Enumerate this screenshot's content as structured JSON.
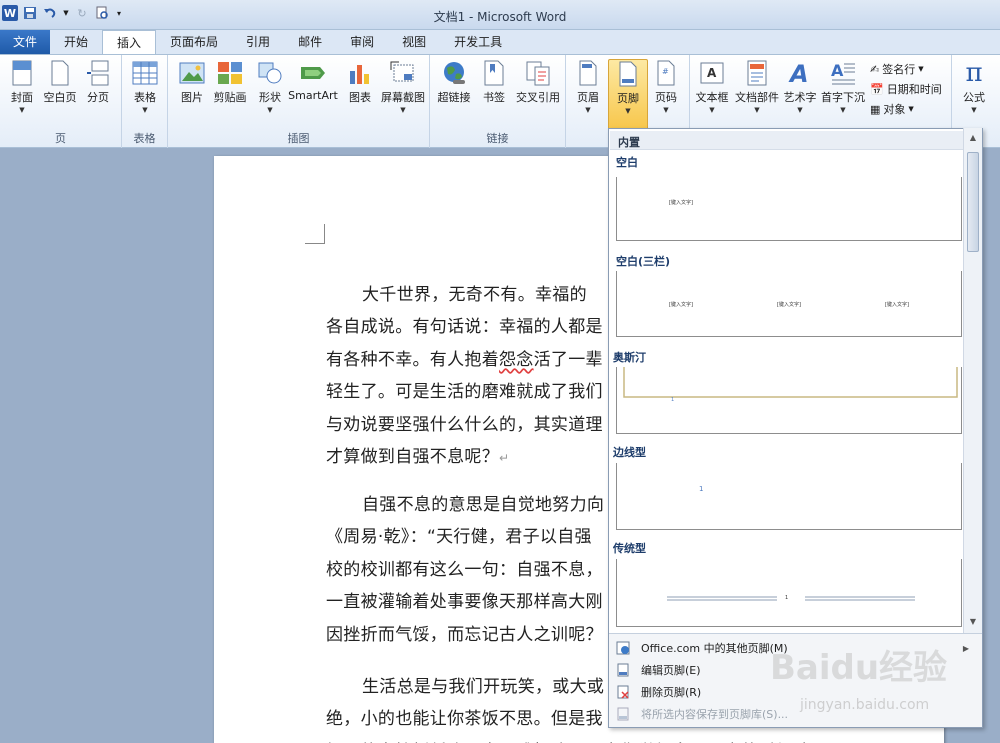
{
  "window": {
    "title": "文档1 - Microsoft Word"
  },
  "tabs": [
    {
      "label": "文件"
    },
    {
      "label": "开始"
    },
    {
      "label": "插入"
    },
    {
      "label": "页面布局"
    },
    {
      "label": "引用"
    },
    {
      "label": "邮件"
    },
    {
      "label": "审阅"
    },
    {
      "label": "视图"
    },
    {
      "label": "开发工具"
    }
  ],
  "ribbon": {
    "groups": {
      "pages": "页",
      "tables": "表格",
      "illustrations": "插图",
      "links": "链接",
      "header_footer": "页"
    },
    "buttons": {
      "cover": "封面",
      "blank_page": "空白页",
      "page_break": "分页",
      "table": "表格",
      "picture": "图片",
      "clipart": "剪贴画",
      "shapes": "形状",
      "smartart": "SmartArt",
      "chart": "图表",
      "screenshot": "屏幕截图",
      "hyperlink": "超链接",
      "bookmark": "书签",
      "crossref": "交叉引用",
      "header": "页眉",
      "footer": "页脚",
      "page_number": "页码",
      "textbox": "文本框",
      "quickparts": "文档部件",
      "wordart": "艺术字",
      "dropcap": "首字下沉",
      "signature": "签名行",
      "datetime": "日期和时间",
      "object": "对象",
      "equation": "公式"
    }
  },
  "document": {
    "paragraphs": [
      [
        "大千世界，无奇不有。幸福的",
        "各自成说。有句话说：幸福的人都是",
        "有各种不幸。有人抱着怨念活了一辈",
        "轻生了。可是生活的磨难就成了我们",
        "与劝说要坚强什么什么的，其实道理",
        "才算做到自强不息呢？"
      ],
      [
        "自强不息的意思是自觉地努力向",
        "《周易·乾》：“天行健，君子以自强",
        "校的校训都有这么一句：自强不息，",
        "一直被灌输着处事要像天那样高大刚",
        "因挫折而气馁，而忘记古人之训呢？"
      ],
      [
        "生活总是与我们开玩笑，或大或",
        "绝，小的也能让你茶饭不思。但是我",
        "轻易的向挫折低头，向困难投降呢？当你觉得自己不幸的时候请"
      ]
    ],
    "squiggle_word": "怨"
  },
  "gallery": {
    "header": "内置",
    "items": [
      {
        "title": "空白",
        "placeholder": "[键入文字]"
      },
      {
        "title": "空白(三栏)",
        "placeholder": "[键入文字]"
      },
      {
        "title": "奥斯汀",
        "placeholder": "1"
      },
      {
        "title": "边线型",
        "placeholder": "1"
      },
      {
        "title": "传统型",
        "placeholder": "1"
      }
    ],
    "menu": [
      {
        "label": "Office.com 中的其他页脚(M)",
        "enabled": true
      },
      {
        "label": "编辑页脚(E)",
        "enabled": true
      },
      {
        "label": "删除页脚(R)",
        "enabled": true
      },
      {
        "label": "将所选内容保存到页脚库(S)...",
        "enabled": false
      }
    ]
  },
  "watermark": {
    "text": "Baidu经验",
    "sub": "jingyan.baidu.com"
  },
  "colors": {
    "file_tab": "#1f5aa8",
    "active_button": "#f7c64a",
    "doc_background": "#9aaec8"
  }
}
